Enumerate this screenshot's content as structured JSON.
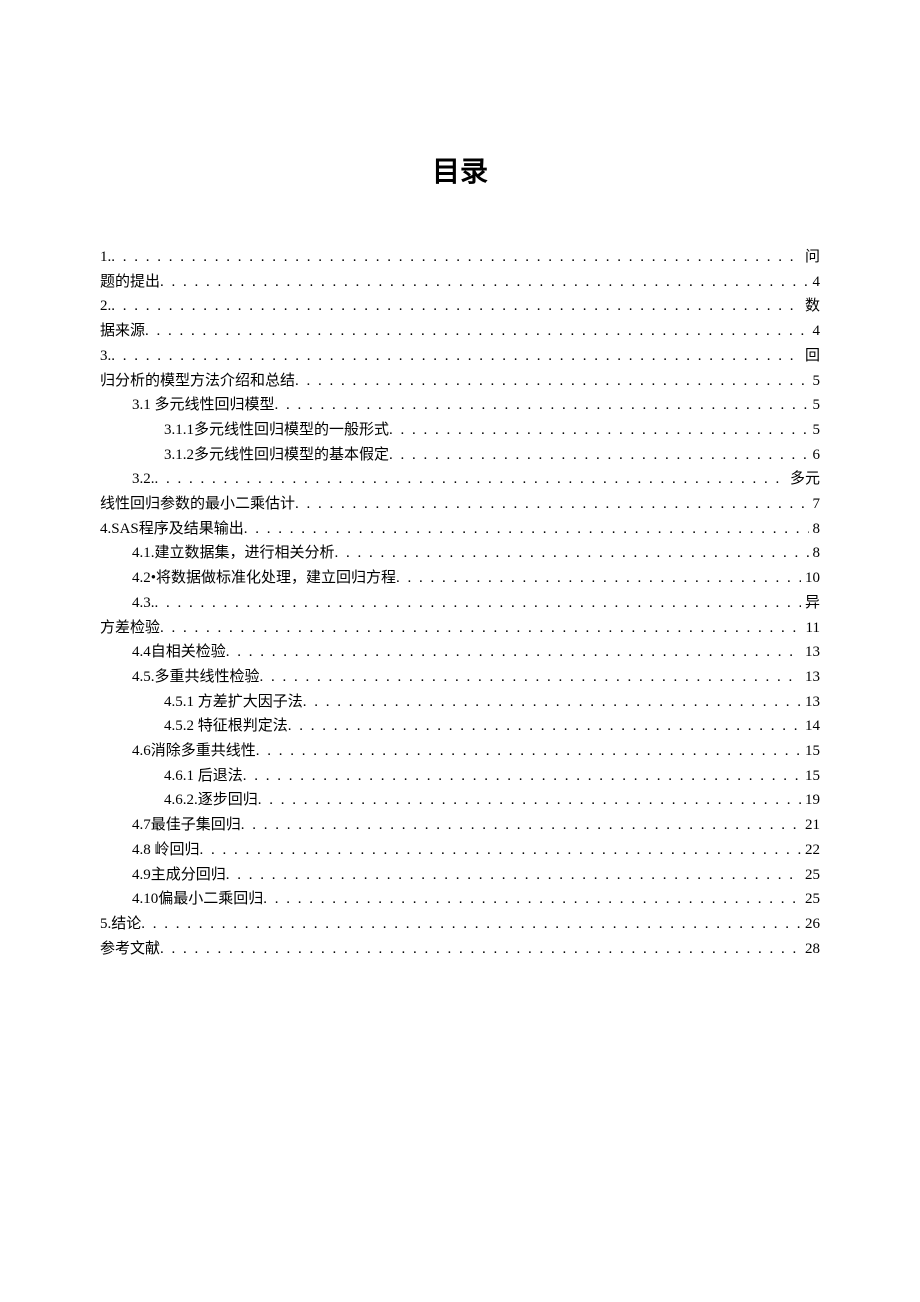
{
  "title": "目录",
  "entries": [
    {
      "indent": 0,
      "text": "1.",
      "page": "问"
    },
    {
      "indent": 0,
      "text": "题的提出",
      "page": "4"
    },
    {
      "indent": 0,
      "text": "2.",
      "page": "数"
    },
    {
      "indent": 0,
      "text": "据来源",
      "page": "4"
    },
    {
      "indent": 0,
      "text": "3.",
      "page": "回"
    },
    {
      "indent": 0,
      "text": "归分析的模型方法介绍和总结",
      "page": "5"
    },
    {
      "indent": 1,
      "text": "3.1 多元线性回归模型",
      "page": "5"
    },
    {
      "indent": 2,
      "text": "3.1.1多元线性回归模型的一般形式",
      "page": "5"
    },
    {
      "indent": 2,
      "text": "3.1.2多元线性回归模型的基本假定",
      "page": "6"
    },
    {
      "indent": 1,
      "text": "3.2.",
      "page": "多元"
    },
    {
      "indent": 0,
      "text": "线性回归参数的最小二乘估计",
      "page": "7"
    },
    {
      "indent": 0,
      "text": "4.SAS程序及结果输出",
      "page": "8"
    },
    {
      "indent": 1,
      "text": "4.1.建立数据集，进行相关分析",
      "page": "8"
    },
    {
      "indent": 1,
      "text": "4.2•将数据做标准化处理，建立回归方程",
      "page": "10"
    },
    {
      "indent": 1,
      "text": "4.3.",
      "page": "异"
    },
    {
      "indent": 0,
      "text": "方差检验",
      "page": "11"
    },
    {
      "indent": 1,
      "text": "4.4自相关检验",
      "page": "13"
    },
    {
      "indent": 1,
      "text": "4.5.多重共线性检验",
      "page": "13"
    },
    {
      "indent": 2,
      "text": "4.5.1 方差扩大因子法",
      "page": "13"
    },
    {
      "indent": 2,
      "text": "4.5.2 特征根判定法",
      "page": "14"
    },
    {
      "indent": 1,
      "text": "4.6消除多重共线性",
      "page": "15"
    },
    {
      "indent": 2,
      "text": "4.6.1 后退法",
      "page": "15"
    },
    {
      "indent": 2,
      "text": "4.6.2.逐步回归",
      "page": "19"
    },
    {
      "indent": 1,
      "text": "4.7最佳子集回归",
      "page": "21"
    },
    {
      "indent": 1,
      "text": "4.8 岭回归",
      "page": "22"
    },
    {
      "indent": 1,
      "text": "4.9主成分回归",
      "page": "25"
    },
    {
      "indent": 1,
      "text": "4.10偏最小二乘回归",
      "page": "25"
    },
    {
      "indent": 0,
      "text": "5.结论",
      "page": "26"
    },
    {
      "indent": 0,
      "text": "参考文献",
      "page": "28"
    }
  ]
}
